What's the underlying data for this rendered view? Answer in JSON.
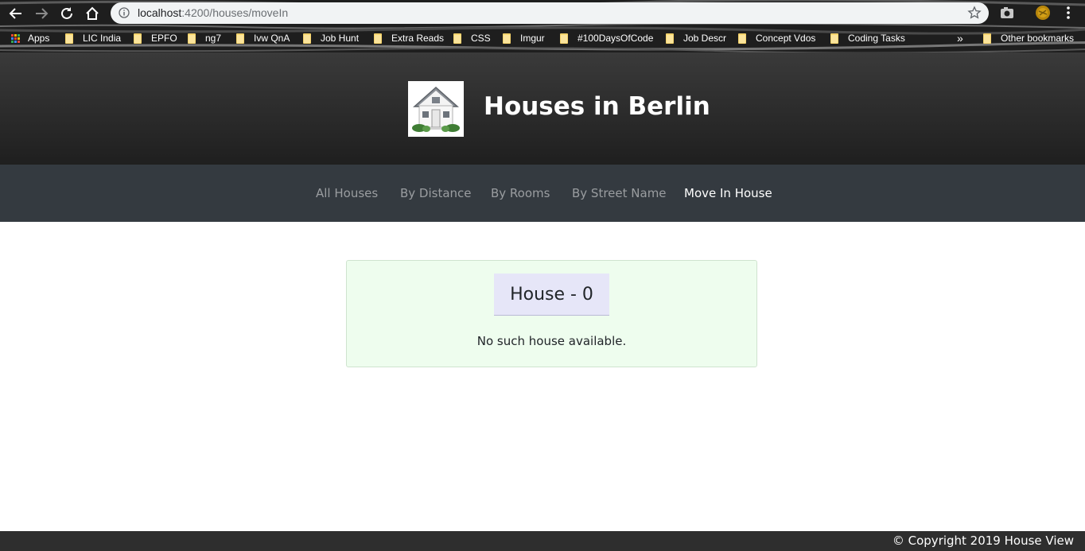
{
  "browser": {
    "url_host": "localhost",
    "url_path": ":4200/houses/moveIn",
    "bookmarks": [
      {
        "label": "Apps",
        "icon": "apps-grid-icon"
      },
      {
        "label": "LIC India",
        "icon": "folder-icon"
      },
      {
        "label": "EPFO",
        "icon": "folder-icon"
      },
      {
        "label": "ng7",
        "icon": "folder-icon"
      },
      {
        "label": "Ivw QnA",
        "icon": "folder-icon"
      },
      {
        "label": "Job Hunt",
        "icon": "folder-icon"
      },
      {
        "label": "Extra Reads",
        "icon": "folder-icon"
      },
      {
        "label": "CSS",
        "icon": "folder-icon"
      },
      {
        "label": "Imgur",
        "icon": "folder-icon"
      },
      {
        "label": "#100DaysOfCode",
        "icon": "folder-icon"
      },
      {
        "label": "Job Descr",
        "icon": "folder-icon"
      },
      {
        "label": "Concept Vdos",
        "icon": "folder-icon"
      },
      {
        "label": "Coding Tasks",
        "icon": "folder-icon"
      }
    ],
    "more_bookmarks": "»",
    "other_bookmarks": "Other bookmarks"
  },
  "header": {
    "title": "Houses in Berlin",
    "logo_icon": "house-icon"
  },
  "nav": {
    "items": [
      {
        "label": "All Houses",
        "active": false
      },
      {
        "label": "By Distance",
        "active": false
      },
      {
        "label": "By Rooms",
        "active": false
      },
      {
        "label": "By Street Name",
        "active": false
      },
      {
        "label": "Move In House",
        "active": true
      }
    ]
  },
  "card": {
    "title": "House - 0",
    "message": "No such house available."
  },
  "footer": {
    "copyright": "© Copyright 2019 House View"
  },
  "colors": {
    "nav_bg": "#343a40",
    "card_bg": "#eefdee",
    "card_title_bg": "#e6e6f8",
    "footer_bg": "#2e2e2e"
  }
}
